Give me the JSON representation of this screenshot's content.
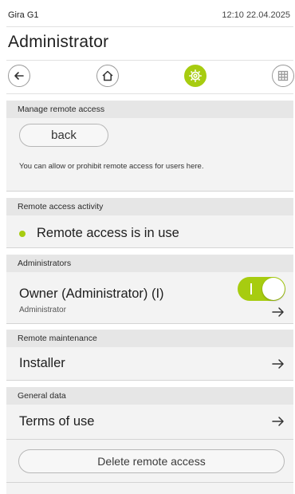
{
  "status_bar": {
    "device": "Gira G1",
    "time": "12:10 22.04.2025"
  },
  "page_title": "Administrator",
  "nav": {
    "back_icon": "arrow-left-icon",
    "home_icon": "home-icon",
    "settings_icon": "gear-icon",
    "grid_icon": "grid-icon"
  },
  "manage_remote": {
    "header": "Manage remote access",
    "back_label": "back",
    "hint": "You can allow or prohibit remote access for users here."
  },
  "activity": {
    "header": "Remote access activity",
    "status": "Remote access is in use"
  },
  "administrators": {
    "header": "Administrators",
    "name": "Owner (Administrator) (I)",
    "role": "Administrator",
    "toggle_on": true
  },
  "maintenance": {
    "header": "Remote maintenance",
    "item": "Installer"
  },
  "general": {
    "header": "General data",
    "item": "Terms of use",
    "delete_label": "Delete remote access"
  },
  "colors": {
    "accent": "#a7cc10",
    "section_bg": "#e6e6e6",
    "panel_bg": "#f3f3f3"
  }
}
